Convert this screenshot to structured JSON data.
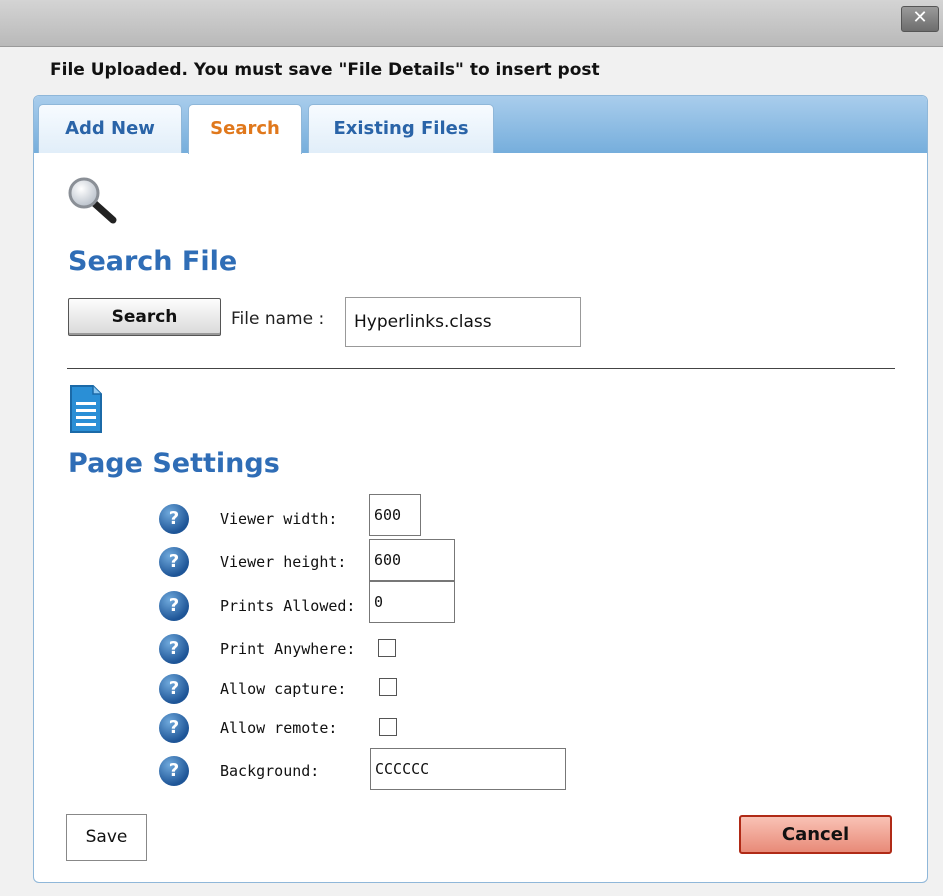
{
  "window": {
    "close_glyph": "✕"
  },
  "banner": "File Uploaded. You must save \"File Details\" to insert post",
  "tabs": [
    {
      "label": "Add New",
      "active": false
    },
    {
      "label": "Search",
      "active": true
    },
    {
      "label": "Existing Files",
      "active": false
    }
  ],
  "search_section": {
    "title": "Search File",
    "button_label": "Search",
    "file_name_label": "File name :",
    "file_name_value": "Hyperlinks.class"
  },
  "page_settings": {
    "title": "Page Settings",
    "help_glyph": "?",
    "fields": {
      "viewer_width": {
        "label": "Viewer width:",
        "value": "600"
      },
      "viewer_height": {
        "label": "Viewer height:",
        "value": "600"
      },
      "prints_allowed": {
        "label": "Prints Allowed:",
        "value": "0"
      },
      "print_anywhere": {
        "label": "Print Anywhere:",
        "checked": false
      },
      "allow_capture": {
        "label": "Allow capture:",
        "checked": false
      },
      "allow_remote": {
        "label": "Allow remote:",
        "checked": false
      },
      "background": {
        "label": "Background:",
        "value": "CCCCCC"
      }
    }
  },
  "actions": {
    "save_label": "Save",
    "cancel_label": "Cancel"
  },
  "colors": {
    "accent_blue": "#2f6db6",
    "active_tab": "#e0781c",
    "cancel_red": "#e88a78"
  },
  "icons": {
    "search": "magnifier-icon",
    "document": "document-icon",
    "help": "help-icon"
  }
}
